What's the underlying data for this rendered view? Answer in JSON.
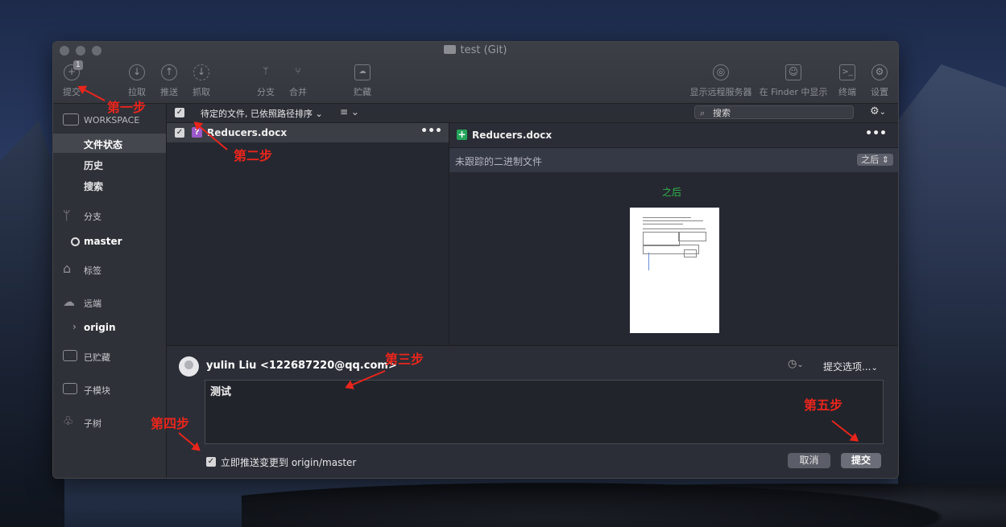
{
  "window": {
    "title": "test (Git)"
  },
  "toolbar": {
    "commit": "提交",
    "commit_badge": "1",
    "pull": "拉取",
    "push": "推送",
    "fetch": "抓取",
    "branch": "分支",
    "merge": "合并",
    "stash": "贮藏",
    "show_remote": "显示远程服务器",
    "show_in_finder": "在 Finder 中显示",
    "terminal": "终端",
    "settings": "设置"
  },
  "sidebar": {
    "workspace": "WORKSPACE",
    "file_status": "文件状态",
    "history": "历史",
    "search": "搜索",
    "branches": "分支",
    "current_branch": "master",
    "tags": "标签",
    "remotes": "远端",
    "remote_origin": "origin",
    "stashes": "已贮藏",
    "submodules": "子模块",
    "subtrees": "子树"
  },
  "filebar": {
    "sort_label": "待定的文件, 已依照路径排序",
    "search_placeholder": "搜索"
  },
  "files": [
    {
      "name": "Reducers.docx",
      "status": "untracked"
    }
  ],
  "preview": {
    "filename": "Reducers.docx",
    "subtitle": "未跟踪的二进制文件",
    "after_select": "之后",
    "after_label": "之后"
  },
  "commit": {
    "author": "yulin Liu <122687220@qq.com>",
    "options": "提交选项...",
    "message": "测试",
    "push_immediately": "立即推送变更到 origin/master",
    "cancel": "取消",
    "submit": "提交"
  },
  "annotations": {
    "step1": "第一步",
    "step2": "第二步",
    "step3": "第三步",
    "step4": "第四步",
    "step5": "第五步"
  },
  "colors": {
    "annotation_red": "#e8251c",
    "added_green": "#23a55a",
    "untracked_purple": "#9b59c9"
  }
}
